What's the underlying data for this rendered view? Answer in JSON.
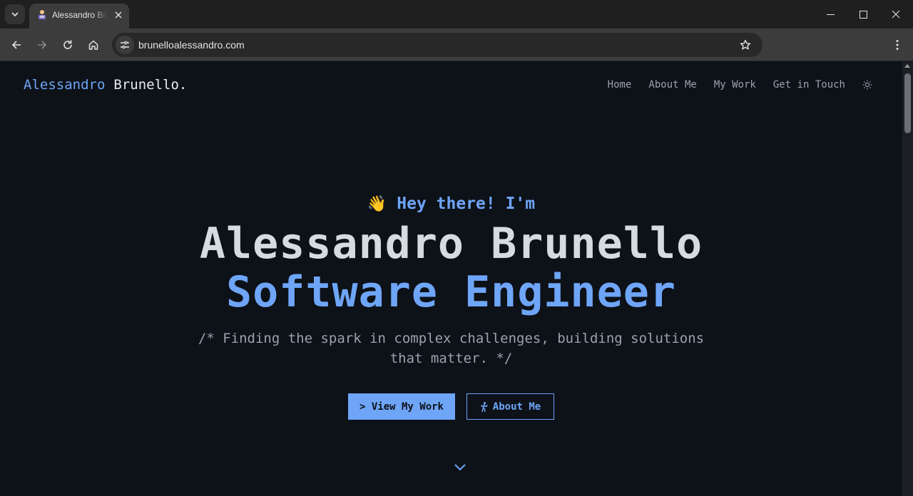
{
  "browser": {
    "tab_title": "Alessandro Brunello",
    "url": "brunelloalessandro.com"
  },
  "page": {
    "brand": {
      "first": "Alessandro",
      "last": "Brunello."
    },
    "nav": [
      {
        "label": "Home"
      },
      {
        "label": "About Me"
      },
      {
        "label": "My Work"
      },
      {
        "label": "Get in Touch"
      }
    ],
    "hero": {
      "wave_emoji": "👋",
      "greeting": "Hey there! I'm",
      "name": "Alessandro Brunello",
      "role": "Software Engineer",
      "tagline": "/* Finding the spark in complex challenges, building solutions that matter. */"
    },
    "buttons": {
      "primary": "> View My Work",
      "secondary": "About Me"
    }
  },
  "colors": {
    "accent": "#6ea5f7",
    "background": "#0d1118",
    "heading": "#d6dbe2",
    "muted": "#9aa3ae"
  },
  "icons": [
    "tab-search-icon",
    "close-icon",
    "minimize-icon",
    "maximize-icon",
    "back-icon",
    "forward-icon",
    "reload-icon",
    "home-icon",
    "site-settings-icon",
    "bookmark-star-icon",
    "menu-icon",
    "sun-icon",
    "walking-icon",
    "chevron-down-icon"
  ]
}
